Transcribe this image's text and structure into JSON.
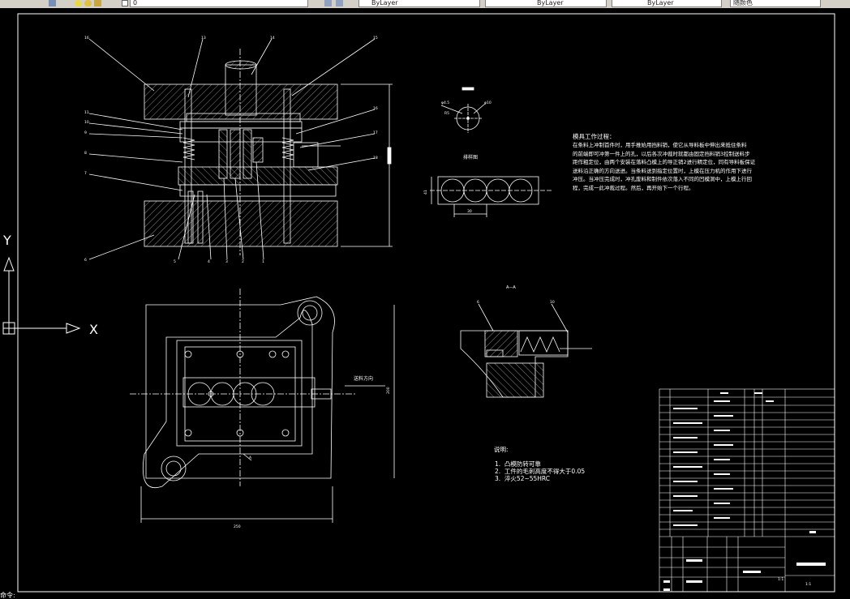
{
  "toolbar": {
    "layer_value": "0",
    "color_value": "ByLayer",
    "linetype_value": "ByLayer",
    "lineweight_value": "ByLayer",
    "plotstyle_value": "随颜色"
  },
  "ucs": {
    "x_label": "X",
    "y_label": "Y"
  },
  "drawing": {
    "work_process_title": "模具工作过程：",
    "work_process_text": "在条料上冲制首件时，用手推始用挡料销，使它从导料板中伸出来抵住条料\n的前端即可冲第一件上的孔，以后各次冲裁时就都由固定挡料销3控制送料步\n距作粗定位，由两个安装在落料凸模上的导正销2进行精定位，同有导料板保证\n送料沿正确的方向送进。当条料送到指定位置时，上模在压力机的作用下进行\n冲压。当冲压完成时，冲孔废料和制件依次落入不同的凹模洞中，上模上行回\n程，完成一此冲裁过程。然后，再开始下一个行程。",
    "notes_title": "说明:",
    "notes": [
      "1.  凸模防转可靠",
      "2.  工件的毛刺高度不得大于0.05",
      "3.  淬火52~55HRC"
    ],
    "layout_label": "排样图",
    "section_label": "A—A",
    "feed_direction_label": "送料方向",
    "scale_label": "1:1"
  },
  "status_text": "命令:"
}
